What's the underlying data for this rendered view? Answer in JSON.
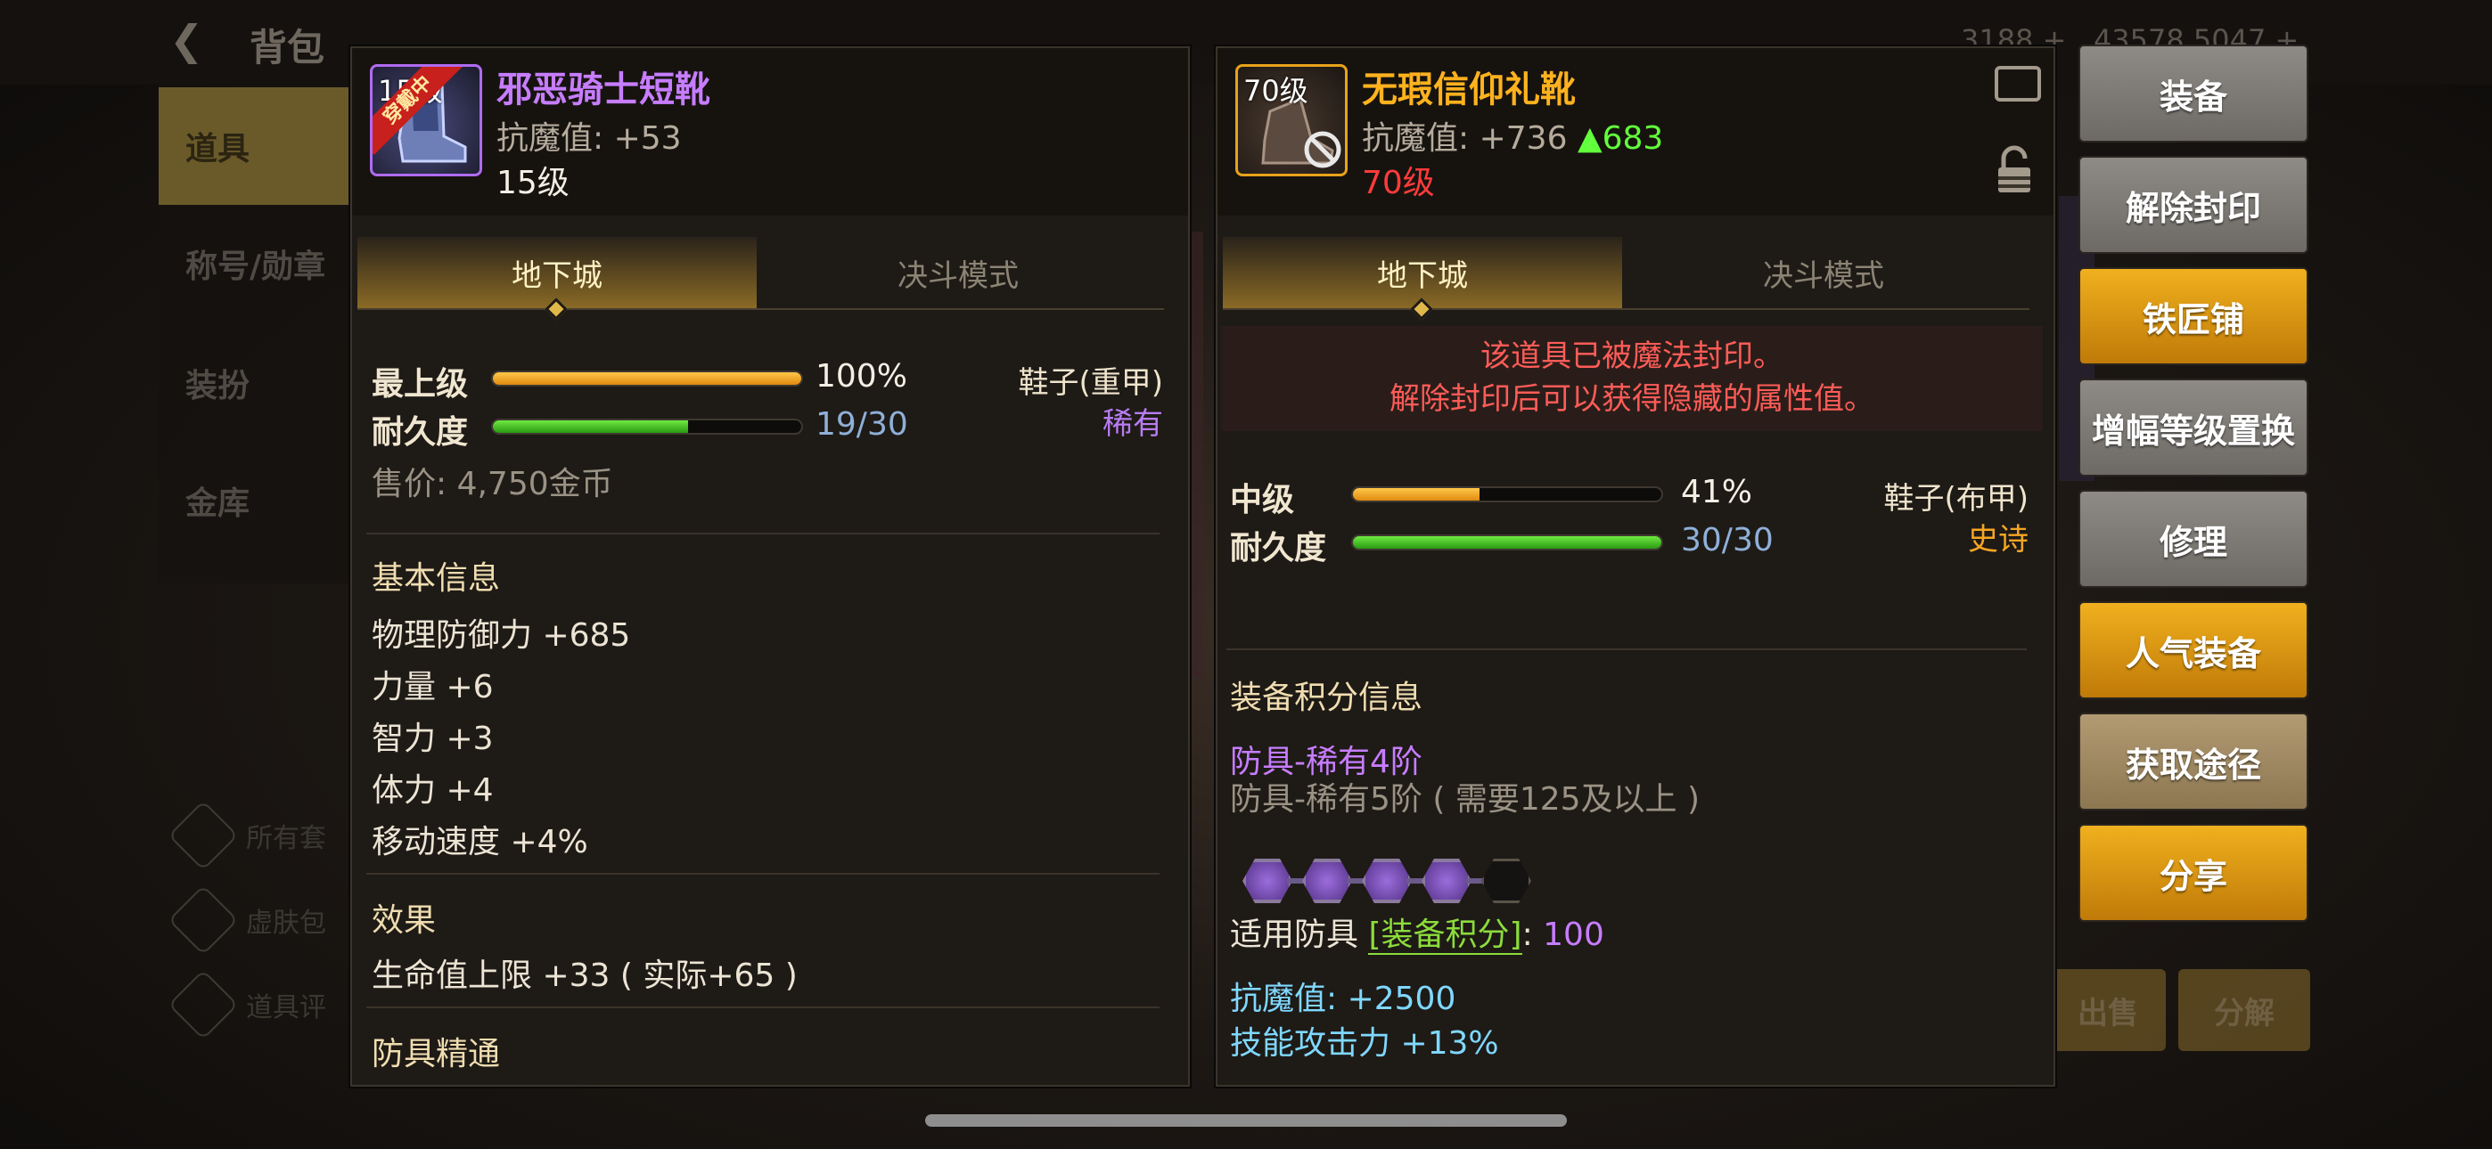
{
  "background": {
    "back_icon": "chevron-left-icon",
    "title": "背包",
    "sidebar_tabs": [
      "道具",
      "称号/勋章",
      "装扮",
      "金库"
    ],
    "selected_tab": "道具",
    "filters": [
      "所有套",
      "虚肤包",
      "道具评"
    ],
    "stat_fragments": [
      "3188",
      "43578",
      "5047"
    ],
    "bottom_buttons": [
      "出售",
      "分解"
    ]
  },
  "left_item": {
    "icon_level": "15级",
    "equipped_badge": "穿戴中",
    "name": "邪恶骑士短靴",
    "stat_label": "抗魔值:",
    "stat_value": "+53",
    "level_text": "15级",
    "tabs": [
      "地下城",
      "决斗模式"
    ],
    "grade_label": "最上级",
    "grade_percent": 100,
    "grade_value": "100%",
    "durability_label": "耐久度",
    "durability_current": 19,
    "durability_max": 30,
    "durability_value": "19/30",
    "slot_type": "鞋子(重甲)",
    "rarity": "稀有",
    "rarity_color": "#b77cf2",
    "sell_price": "售价: 4,750金币",
    "basic_info_title": "基本信息",
    "basic_stats": [
      "物理防御力 +685",
      "力量 +6",
      "智力 +3",
      "体力 +4",
      "移动速度 +4%"
    ],
    "effect_title": "效果",
    "effects": [
      "生命值上限 +33 ( 实际+65 )"
    ],
    "mastery_title": "防具精通"
  },
  "right_item": {
    "icon_level": "70级",
    "name": "无瑕信仰礼靴",
    "stat_label": "抗魔值:",
    "stat_value": "+736",
    "stat_delta": "▲683",
    "level_text": "70级",
    "tabs": [
      "地下城",
      "决斗模式"
    ],
    "sealed_notice": [
      "该道具已被魔法封印。",
      "解除封印后可以获得隐藏的属性值。"
    ],
    "grade_label": "中级",
    "grade_percent": 41,
    "grade_value": "41%",
    "durability_label": "耐久度",
    "durability_current": 30,
    "durability_max": 30,
    "durability_value": "30/30",
    "slot_type": "鞋子(布甲)",
    "rarity": "史诗",
    "rarity_color": "#f5a623",
    "score_title": "装备积分信息",
    "score_tier_current": "防具-稀有4阶",
    "score_tier_next": "防具-稀有5阶 ( 需要125及以上 )",
    "score_gems_filled": 4,
    "score_gems_total": 5,
    "score_prefix": "适用防具",
    "score_link": "[装备积分]",
    "score_colon": ":",
    "score_value": "100",
    "bonus_stats": [
      "抗魔值: +2500",
      "技能攻击力 +13%"
    ]
  },
  "actions": [
    {
      "label": "装备",
      "style": "gray"
    },
    {
      "label": "解除封印",
      "style": "gray"
    },
    {
      "label": "铁匠铺",
      "style": "gold"
    },
    {
      "label": "增幅等级置换",
      "style": "gray"
    },
    {
      "label": "修理",
      "style": "gray"
    },
    {
      "label": "人气装备",
      "style": "gold"
    },
    {
      "label": "获取途径",
      "style": "tan"
    },
    {
      "label": "分享",
      "style": "gold"
    }
  ],
  "colors": {
    "epic_name": "#c77dff",
    "legend_name": "#ffb21e",
    "delta_green": "#62ff3c",
    "required_red": "#ff3b3b",
    "cyan_stat": "#7fd8ff"
  }
}
